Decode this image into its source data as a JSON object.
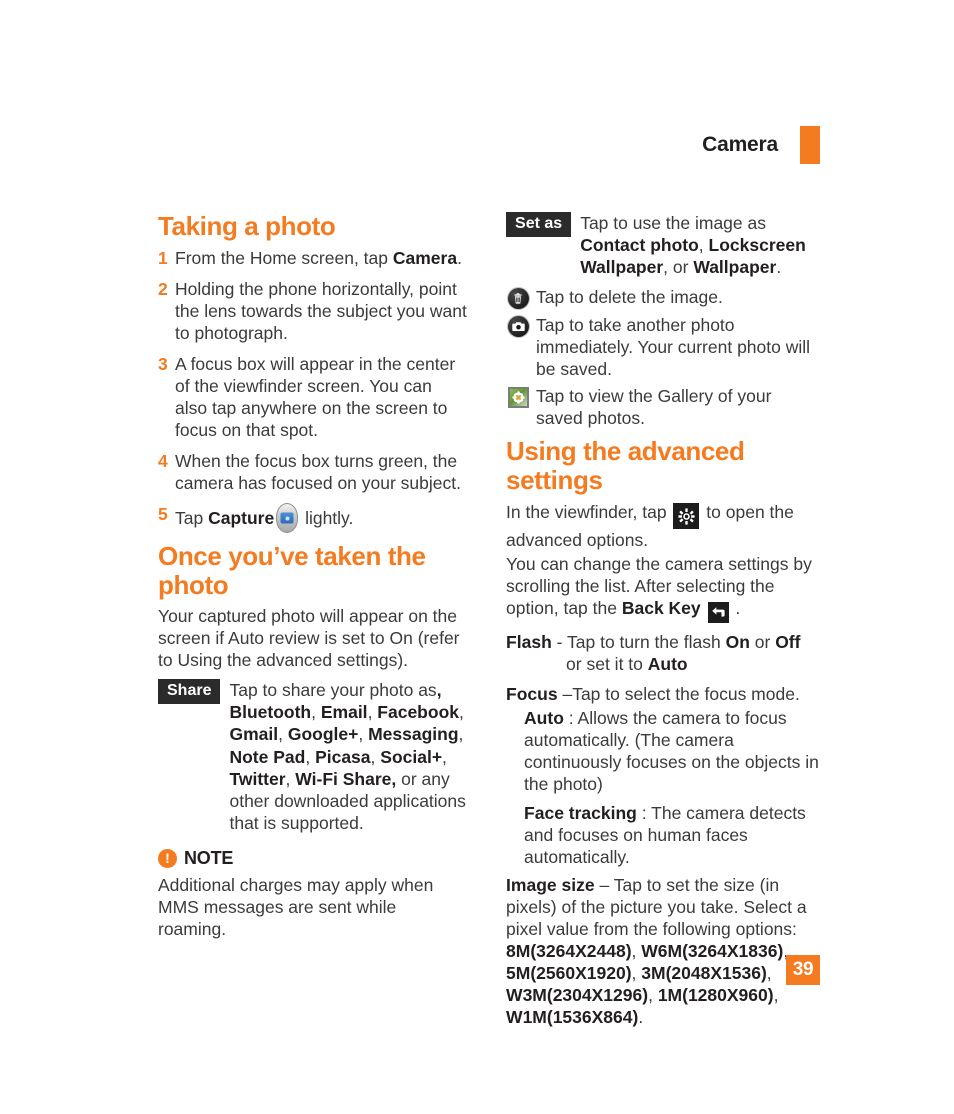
{
  "header": {
    "title": "Camera",
    "tab_color": "#f47b20"
  },
  "page_number": "39",
  "colors": {
    "accent": "#f47b20",
    "body_text": "#3b3b3b",
    "chip_bg": "#2b2b2b"
  },
  "left_column": {
    "heading_taking": "Taking a photo",
    "steps": [
      {
        "num": "1",
        "text_prefix": "From the Home screen, tap ",
        "bold": "Camera",
        "text_suffix": "."
      },
      {
        "num": "2",
        "text_prefix": "Holding the phone horizontally, point the lens towards the subject you want to photograph.",
        "bold": "",
        "text_suffix": ""
      },
      {
        "num": "3",
        "text_prefix": "A focus box will appear in the center of the viewfinder screen. You can also tap anywhere on the screen to focus on that spot.",
        "bold": "",
        "text_suffix": ""
      },
      {
        "num": "4",
        "text_prefix": "When the focus box turns green, the camera has focused on your subject.",
        "bold": "",
        "text_suffix": ""
      },
      {
        "num": "5",
        "text_prefix": "Tap ",
        "bold": "Capture",
        "text_suffix": " lightly."
      }
    ],
    "heading_once": "Once you’ve taken the photo",
    "captured_paragraph": "Your captured photo will appear on the screen if Auto review is set to On (refer to Using the advanced settings).",
    "share_chip": "Share",
    "share_intro": "Tap to share your photo as",
    "share_apps": [
      "Bluetooth",
      "Email",
      "Facebook",
      "Gmail",
      "Google+",
      "Messaging",
      "Note Pad",
      "Picasa",
      "Social+",
      "Twitter",
      "Wi-Fi Share,"
    ],
    "share_tail": "or any other downloaded applications that is supported.",
    "note_badge": "!",
    "note_label": "NOTE",
    "note_text": "Additional charges may apply when MMS messages are sent while roaming."
  },
  "right_column": {
    "set_as_chip": "Set as",
    "set_as_text_1": "Tap to use the image as ",
    "set_as_bold_1": "Contact photo",
    "set_as_sep_1": ", ",
    "set_as_bold_2": "Lockscreen Wallpaper",
    "set_as_sep_2": ", or ",
    "set_as_bold_3": "Wallpaper",
    "set_as_end": ".",
    "icon_rows": [
      {
        "icon": "trash-icon",
        "text": "Tap to delete the image."
      },
      {
        "icon": "camera-icon",
        "text": "Tap to take another photo immediately. Your current photo will be saved."
      },
      {
        "icon": "gallery-icon",
        "text": "Tap to view the Gallery of your saved photos."
      }
    ],
    "heading_advanced": "Using the advanced settings",
    "viewfinder_text_1": "In the viewfinder, tap ",
    "viewfinder_text_2": " to open the advanced options.",
    "change_settings_1": "You can change the camera settings by scrolling the list. After selecting the option, tap the ",
    "change_settings_bold": "Back Key",
    "change_settings_2": " .",
    "flash_label": "Flash",
    "flash_text_1": " - Tap to turn the flash ",
    "flash_on": "On",
    "flash_or": " or ",
    "flash_off": "Off",
    "flash_text_2": " or set it to ",
    "flash_auto": "Auto",
    "focus_label": "Focus",
    "focus_text": " –Tap to select the focus mode.",
    "focus_auto_label": "Auto",
    "focus_auto_text": " : Allows the camera to focus automatically. (The camera continuously focuses on the objects in the photo)",
    "focus_face_label": "Face tracking",
    "focus_face_text": " : The camera detects and focuses on human faces automatically.",
    "image_size_label": "Image size",
    "image_size_text": " – Tap to set the size (in pixels) of the picture you take. Select a pixel value from the following options: ",
    "image_size_options": [
      "8M(3264X2448)",
      "W6M(3264X1836)",
      "5M(2560X1920)",
      "3M(2048X1536)",
      "W3M(2304X1296)",
      "1M(1280X960)",
      "W1M(1536X864)"
    ],
    "image_size_end": "."
  }
}
